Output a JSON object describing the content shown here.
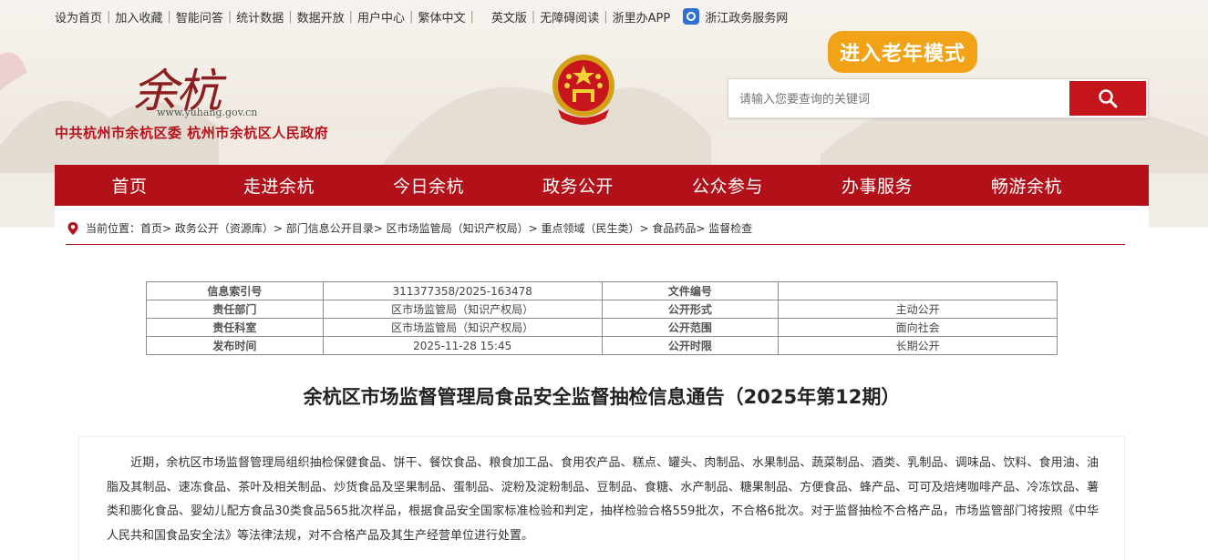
{
  "topbar": {
    "links": [
      "设为首页",
      "加入收藏",
      "智能问答",
      "统计数据",
      "数据开放",
      "用户中心",
      "繁体中文"
    ],
    "links2": [
      "英文版",
      "无障碍阅读"
    ],
    "app_label": "浙里办APP",
    "zj_label": "浙江政务服务网"
  },
  "header": {
    "logo_text": "余杭",
    "logo_url": "www.yuhang.gov.cn",
    "site_name": "中共杭州市余杭区委  杭州市余杭区人民政府",
    "elder_mode": "进入老年模式"
  },
  "search": {
    "placeholder": "请输入您要查询的关键词"
  },
  "nav": {
    "items": [
      "首页",
      "走进余杭",
      "今日余杭",
      "政务公开",
      "公众参与",
      "办事服务",
      "畅游余杭"
    ]
  },
  "breadcrumb": {
    "text": "当前位置：首页> 政务公开（资源库）> 部门信息公开目录> 区市场监管局（知识产权局）> 重点领域（民生类）> 食品药品> 监督检查"
  },
  "info_table": {
    "rows": [
      {
        "k1": "信息索引号",
        "v1": "311377358/2025-163478",
        "k2": "文件编号",
        "v2": ""
      },
      {
        "k1": "责任部门",
        "v1": "区市场监管局（知识产权局）",
        "k2": "公开形式",
        "v2": "主动公开"
      },
      {
        "k1": "责任科室",
        "v1": "区市场监管局（知识产权局）",
        "k2": "公开范围",
        "v2": "面向社会"
      },
      {
        "k1": "发布时间",
        "v1": "2025-11-28 15:45",
        "k2": "公开时限",
        "v2": "长期公开"
      }
    ]
  },
  "article": {
    "title": "余杭区市场监督管理局食品安全监督抽检信息通告（2025年第12期）",
    "paragraph": "近期，余杭区市场监督管理局组织抽检保健食品、饼干、餐饮食品、粮食加工品、食用农产品、糕点、罐头、肉制品、水果制品、蔬菜制品、酒类、乳制品、调味品、饮料、食用油、油脂及其制品、速冻食品、茶叶及相关制品、炒货食品及坚果制品、蛋制品、淀粉及淀粉制品、豆制品、食糖、水产制品、糖果制品、方便食品、蜂产品、可可及焙烤咖啡产品、冷冻饮品、薯类和膨化食品、婴幼儿配方食品30类食品565批次样品，根据食品安全国家标准检验和判定，抽样检验合格559批次，不合格6批次。对于监督抽检不合格产品，市场监管部门将按照《中华人民共和国食品安全法》等法律法规，对不合格产品及其生产经营单位进行处置。"
  },
  "colors": {
    "brand_red": "#b3111a",
    "elder_orange": "#f2a216"
  }
}
